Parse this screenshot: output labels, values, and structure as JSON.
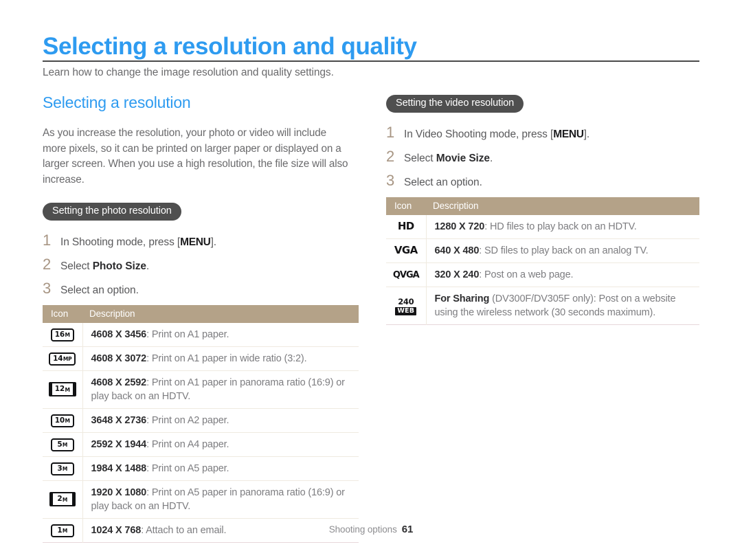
{
  "page": {
    "title": "Selecting a resolution and quality",
    "intro": "Learn how to change the image resolution and quality settings.",
    "accent_blue": "#2e9bf0",
    "pill_bg": "#4f4f4f",
    "table_header_bg": "#b4a288",
    "step_number_color": "#a89684"
  },
  "footer": {
    "label": "Shooting options",
    "page_number": "61"
  },
  "left_column": {
    "section_heading": "Selecting a resolution",
    "body_text": "As you increase the resolution, your photo or video will include more pixels, so it can be printed on larger paper or displayed on a larger screen. When you use a high resolution, the file size will also increase.",
    "pill_label": "Setting the photo resolution",
    "steps": [
      {
        "num": "1",
        "pre": "In Shooting mode, press [",
        "key": "MENU",
        "post": "]."
      },
      {
        "num": "2",
        "pre": "Select ",
        "bold": "Photo Size",
        "post": "."
      },
      {
        "num": "3",
        "pre": "Select an option.",
        "post": ""
      }
    ],
    "table": {
      "headers": {
        "icon": "Icon",
        "description": "Description"
      },
      "rows": [
        {
          "icon_main": "16",
          "icon_sub": "M",
          "icon_shape": "normal",
          "res": "4608 X 3456",
          "desc": ": Print on A1 paper."
        },
        {
          "icon_main": "14",
          "icon_sub": "MP",
          "icon_shape": "normal",
          "res": "4608 X 3072",
          "desc": ": Print on A1 paper in wide ratio (3:2)."
        },
        {
          "icon_main": "12",
          "icon_sub": "M",
          "icon_shape": "wide",
          "res": "4608 X 2592",
          "desc": ": Print on A1 paper in panorama ratio (16:9) or play back on an HDTV."
        },
        {
          "icon_main": "10",
          "icon_sub": "M",
          "icon_shape": "normal",
          "res": "3648 X 2736",
          "desc": ": Print on A2 paper."
        },
        {
          "icon_main": "5",
          "icon_sub": "M",
          "icon_shape": "normal",
          "res": "2592 X 1944",
          "desc": ": Print on A4 paper."
        },
        {
          "icon_main": "3",
          "icon_sub": "M",
          "icon_shape": "normal",
          "res": "1984 X 1488",
          "desc": ": Print on A5 paper."
        },
        {
          "icon_main": "2",
          "icon_sub": "M",
          "icon_shape": "wide",
          "res": "1920 X 1080",
          "desc": ": Print on A5 paper in panorama ratio (16:9) or play back on an HDTV."
        },
        {
          "icon_main": "1",
          "icon_sub": "M",
          "icon_shape": "normal",
          "res": "1024 X 768",
          "desc": ": Attach to an email."
        }
      ]
    }
  },
  "right_column": {
    "pill_label": "Setting the video resolution",
    "steps": [
      {
        "num": "1",
        "pre": "In Video Shooting mode, press [",
        "key": "MENU",
        "post": "]."
      },
      {
        "num": "2",
        "pre": "Select ",
        "bold": "Movie Size",
        "post": "."
      },
      {
        "num": "3",
        "pre": "Select an option.",
        "post": ""
      }
    ],
    "table": {
      "headers": {
        "icon": "Icon",
        "description": "Description"
      },
      "rows": [
        {
          "icon_text": "HD",
          "icon_type": "text",
          "res": "1280 X 720",
          "desc": ": HD files to play back on an HDTV."
        },
        {
          "icon_text": "VGA",
          "icon_type": "text",
          "res": "640 X 480",
          "desc": ": SD files to play back on an analog TV."
        },
        {
          "icon_text": "QVGA",
          "icon_type": "text-small",
          "res": "320 X 240",
          "desc": ": Post on a web page."
        },
        {
          "icon_top": "240",
          "icon_bottom": "WEB",
          "icon_type": "stack",
          "res": "For Sharing",
          "desc": " (DV300F/DV305F only): Post on a website using the wireless network (30 seconds maximum)."
        }
      ]
    }
  }
}
